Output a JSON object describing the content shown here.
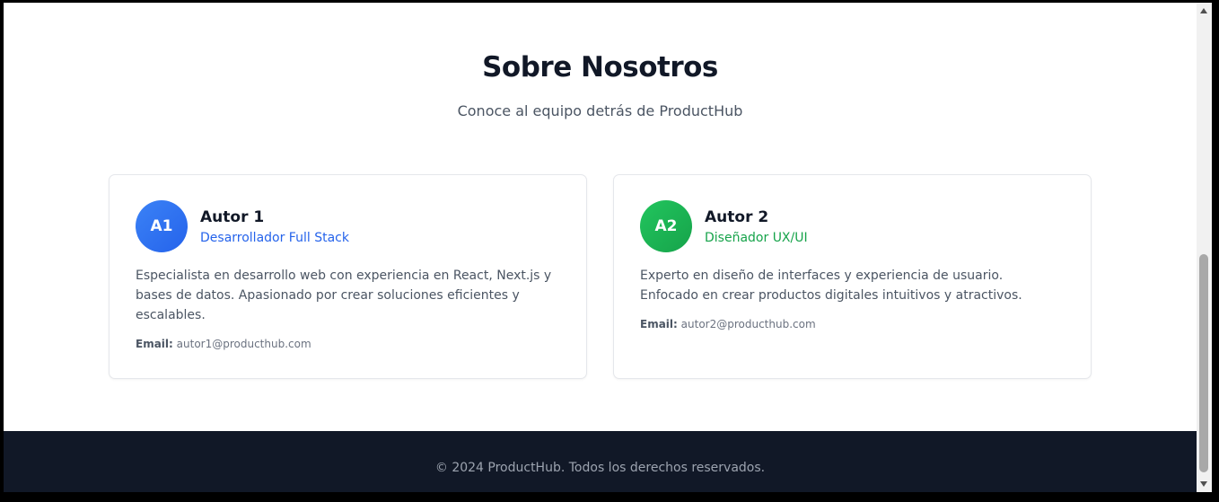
{
  "header": {
    "title": "Sobre Nosotros",
    "subtitle": "Conoce al equipo detrás de ProductHub"
  },
  "team": [
    {
      "initials": "A1",
      "name": "Autor 1",
      "role": "Desarrollador Full Stack",
      "bio": "Especialista en desarrollo web con experiencia en React, Next.js y bases de datos. Apasionado por crear soluciones eficientes y escalables.",
      "email_label": "Email:",
      "email": "autor1@producthub.com",
      "accent": "#2563eb"
    },
    {
      "initials": "A2",
      "name": "Autor 2",
      "role": "Diseñador UX/UI",
      "bio": "Experto en diseño de interfaces y experiencia de usuario. Enfocado en crear productos digitales intuitivos y atractivos.",
      "email_label": "Email:",
      "email": "autor2@producthub.com",
      "accent": "#16a34a"
    }
  ],
  "footer": {
    "text": "© 2024 ProductHub. Todos los derechos reservados."
  }
}
